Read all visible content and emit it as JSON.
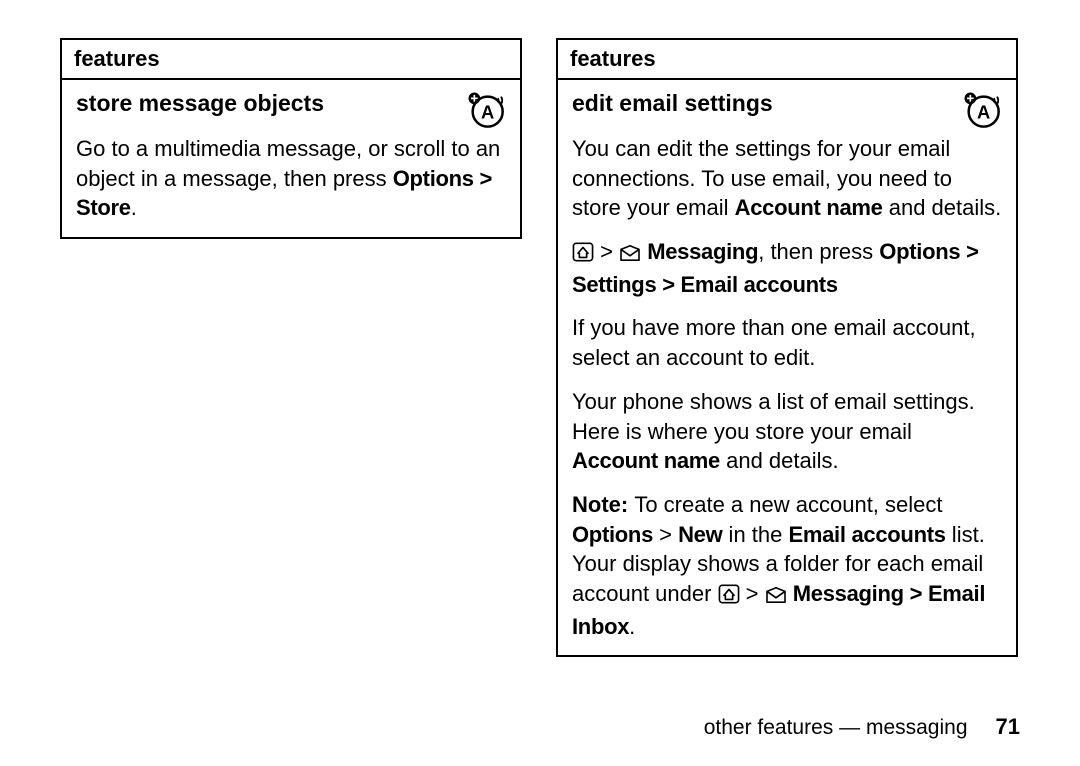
{
  "left": {
    "header": "features",
    "title": "store message objects",
    "body1a": "Go to a multimedia message, or scroll to an object in a message, then press ",
    "body1b_bold": "Options > Store",
    "body1c": "."
  },
  "right": {
    "header": "features",
    "title": "edit email settings",
    "p1a": "You can edit the settings for your email connections. To use email, you need to store your email ",
    "p1b_bold": "Account name",
    "p1c": " and details.",
    "p2b_bold": "Messaging",
    "p2c": ", then press ",
    "p2d_bold": "Options",
    "p2e": "",
    "p2f_bold": " > Settings > Email accounts",
    "p3": "If you have more than one email account, select an account to edit.",
    "p4a": "Your phone shows a list of email settings. Here is where you store your email ",
    "p4b_bold": "Account name",
    "p4c": " and details.",
    "p5a_bold": "Note: ",
    "p5b": "To create a new account, select ",
    "p5c_bold": "Options",
    "p5d": " > ",
    "p5e_bold": "New",
    "p5f": " in the ",
    "p5g_bold": "Email accounts",
    "p5h": " list. Your display shows a folder for each email account under ",
    "p5j_bold": "Messaging",
    "p5k_bold": " > Email Inbox",
    "p5l": "."
  },
  "footer": {
    "text": "other features — messaging",
    "page": "71"
  }
}
